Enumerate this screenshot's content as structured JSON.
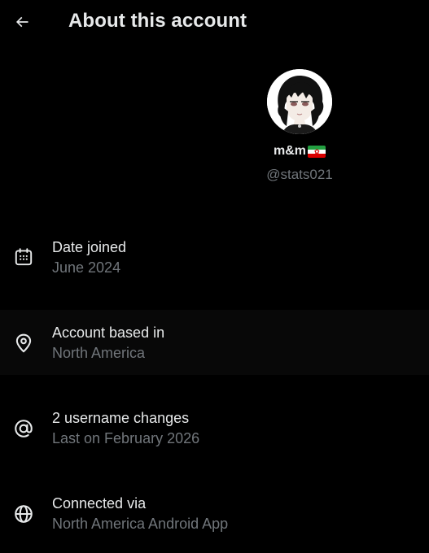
{
  "header": {
    "title": "About this account",
    "back_icon": "arrow-left-icon"
  },
  "profile": {
    "display_name": "m&m",
    "flag_icon": "iran-flag-icon",
    "handle": "@stats021"
  },
  "info": [
    {
      "icon": "calendar-icon",
      "title": "Date joined",
      "value": "June 2024"
    },
    {
      "icon": "location-pin-icon",
      "title": "Account based in",
      "value": "North America"
    },
    {
      "icon": "at-sign-icon",
      "title": "2 username changes",
      "value": "Last on February 2026"
    },
    {
      "icon": "globe-icon",
      "title": "Connected via",
      "value": "North America Android App"
    }
  ],
  "colors": {
    "background": "#000000",
    "primary_text": "#e7e9ea",
    "secondary_text": "#71767b",
    "highlight_row": "#080808"
  }
}
